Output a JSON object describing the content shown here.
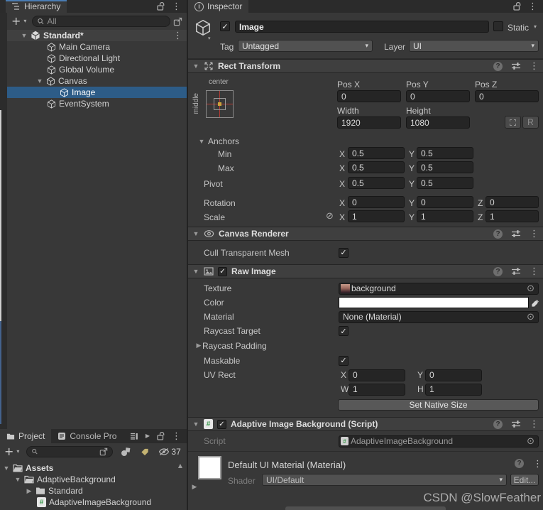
{
  "watermark": "CSDN @SlowFeather",
  "hierarchy": {
    "tab_label": "Hierarchy",
    "search_placeholder": "All",
    "scene_row": "Standard*",
    "items": [
      {
        "label": "Main Camera"
      },
      {
        "label": "Directional Light"
      },
      {
        "label": "Global Volume"
      },
      {
        "label": "Canvas"
      },
      {
        "label": "Image"
      },
      {
        "label": "EventSystem"
      }
    ]
  },
  "project": {
    "tab_project": "Project",
    "tab_console": "Console Pro",
    "hidden_count": "37",
    "tree": [
      {
        "label": "Assets"
      },
      {
        "label": "AdaptiveBackground"
      },
      {
        "label": "Standard"
      },
      {
        "label": "AdaptiveImageBackground"
      }
    ]
  },
  "inspector": {
    "tab_label": "Inspector",
    "game_object": {
      "name": "Image",
      "static_label": "Static",
      "tag_label": "Tag",
      "tag_value": "Untagged",
      "layer_label": "Layer",
      "layer_value": "UI"
    },
    "rect_transform": {
      "title": "Rect Transform",
      "anchor_h": "center",
      "anchor_v": "middle",
      "pos_x_label": "Pos X",
      "pos_y_label": "Pos Y",
      "pos_z_label": "Pos Z",
      "pos_x": "0",
      "pos_y": "0",
      "pos_z": "0",
      "width_label": "Width",
      "height_label": "Height",
      "width": "1920",
      "height": "1080",
      "r_button": "R",
      "anchors_label": "Anchors",
      "min_label": "Min",
      "min_x": "0.5",
      "min_y": "0.5",
      "max_label": "Max",
      "max_x": "0.5",
      "max_y": "0.5",
      "pivot_label": "Pivot",
      "pivot_x": "0.5",
      "pivot_y": "0.5",
      "rotation_label": "Rotation",
      "rotation_x": "0",
      "rotation_y": "0",
      "rotation_z": "0",
      "scale_label": "Scale",
      "scale_x": "1",
      "scale_y": "1",
      "scale_z": "1",
      "x_label": "X",
      "y_label": "Y",
      "z_label": "Z",
      "w_label": "W",
      "h_label": "H"
    },
    "canvas_renderer": {
      "title": "Canvas Renderer",
      "cull_label": "Cull Transparent Mesh"
    },
    "raw_image": {
      "title": "Raw Image",
      "texture_label": "Texture",
      "texture_value": "background",
      "color_label": "Color",
      "material_label": "Material",
      "material_value": "None (Material)",
      "raycast_target_label": "Raycast Target",
      "raycast_padding_label": "Raycast Padding",
      "maskable_label": "Maskable",
      "uv_rect_label": "UV Rect",
      "uv_x": "0",
      "uv_y": "0",
      "uv_w": "1",
      "uv_h": "1",
      "set_native_size_button": "Set Native Size"
    },
    "adaptive_script": {
      "title": "Adaptive Image Background (Script)",
      "script_label": "Script",
      "script_value": "AdaptiveImageBackground",
      "material_title": "Default UI Material (Material)",
      "shader_label": "Shader",
      "shader_value": "UI/Default",
      "edit_button": "Edit..."
    }
  },
  "colors": {
    "selection": "#2D5C87",
    "tab_highlight": "#4A7CB3",
    "script_green": "#3E9B4F"
  }
}
